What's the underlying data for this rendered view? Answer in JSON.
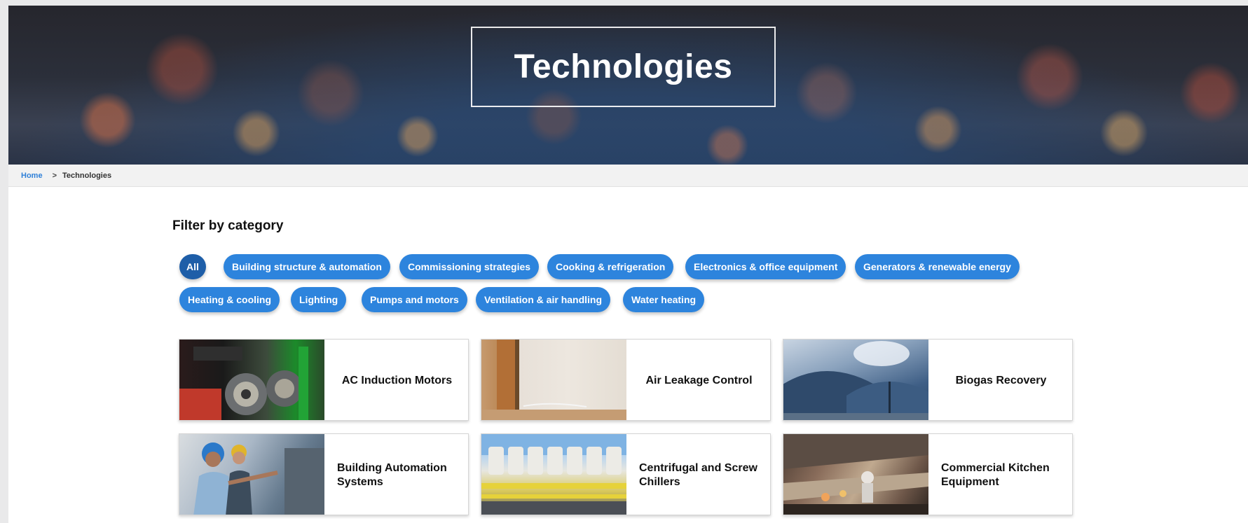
{
  "hero": {
    "title": "Technologies"
  },
  "breadcrumb": {
    "home": "Home",
    "separator": ">",
    "current": "Technologies"
  },
  "filter": {
    "heading": "Filter by category",
    "pills": [
      {
        "label": "All",
        "active": true
      },
      {
        "label": "Building structure & automation"
      },
      {
        "label": "Commissioning strategies"
      },
      {
        "label": "Cooking & refrigeration"
      },
      {
        "label": "Electronics & office equipment"
      },
      {
        "label": "Generators & renewable energy"
      },
      {
        "label": "Heating & cooling"
      },
      {
        "label": "Lighting"
      },
      {
        "label": "Pumps and motors"
      },
      {
        "label": "Ventilation & air handling"
      },
      {
        "label": "Water heating"
      }
    ]
  },
  "cards": [
    {
      "title": "AC Induction Motors",
      "image": "motors-photo"
    },
    {
      "title": "Air Leakage Control",
      "image": "window-frame-photo"
    },
    {
      "title": "Biogas Recovery",
      "image": "biogas-tanks-photo"
    },
    {
      "title": "Building Automation Systems",
      "image": "technicians-control-panel-photo"
    },
    {
      "title": "Centrifugal and Screw Chillers",
      "image": "chillers-photo"
    },
    {
      "title": "Commercial Kitchen Equipment",
      "image": "commercial-kitchen-photo"
    }
  ],
  "colors": {
    "accent": "#2d84dd",
    "accent_active": "#1e5ea8",
    "link": "#2f80d8"
  }
}
